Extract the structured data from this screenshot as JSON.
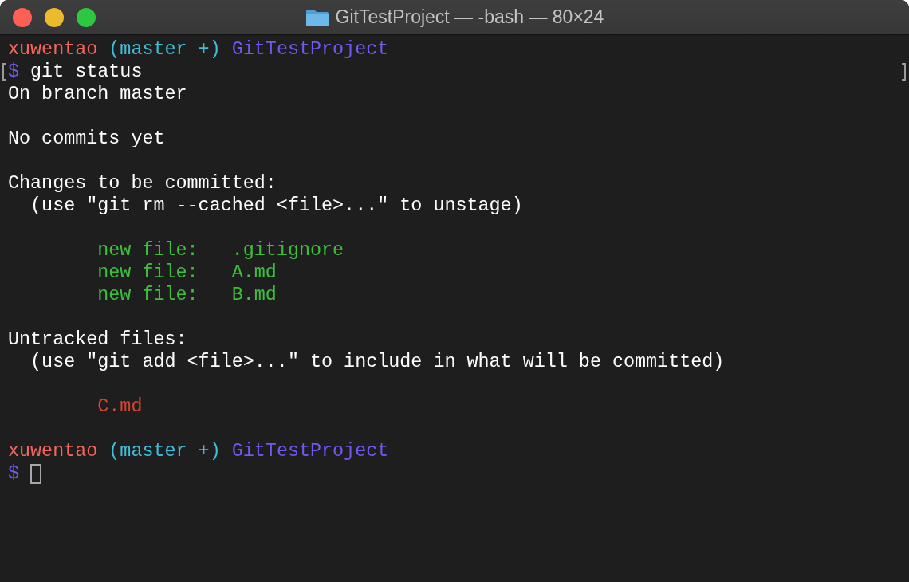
{
  "window": {
    "title": "GitTestProject — -bash — 80×24"
  },
  "blocks": [
    [
      {
        "kind": "prompt",
        "marked": false,
        "cursor": false,
        "segments": [
          {
            "text": "xuwentao",
            "color": "#f2665d"
          },
          {
            "text": "(master +)",
            "color": "#40bfdc"
          },
          {
            "text": "GitTestProject",
            "color": "#7657f0"
          }
        ]
      },
      {
        "kind": "command",
        "marked": true,
        "cursor": false,
        "segments": [
          {
            "text": "$",
            "color": "#7657f0"
          },
          {
            "text": "git status",
            "color": "#ffffff"
          }
        ]
      },
      {
        "kind": "output",
        "marked": false,
        "cursor": false,
        "segments": [
          {
            "text": "On branch master",
            "color": "#ffffff"
          }
        ]
      }
    ],
    [
      {
        "kind": "output",
        "marked": false,
        "cursor": false,
        "segments": [
          {
            "text": "No commits yet",
            "color": "#ffffff"
          }
        ]
      }
    ],
    [
      {
        "kind": "output",
        "marked": false,
        "cursor": false,
        "segments": [
          {
            "text": "Changes to be committed:",
            "color": "#ffffff"
          }
        ]
      },
      {
        "kind": "hint",
        "marked": false,
        "cursor": false,
        "segments": [
          {
            "text": "(use \"git rm --cached <file>...\" to unstage)",
            "color": "#ffffff"
          }
        ]
      }
    ],
    [
      {
        "kind": "entry",
        "marked": false,
        "cursor": false,
        "segments": [
          {
            "text": "new file:   .gitignore",
            "color": "#3cc03c"
          }
        ]
      },
      {
        "kind": "entry",
        "marked": false,
        "cursor": false,
        "segments": [
          {
            "text": "new file:   A.md",
            "color": "#3cc03c"
          }
        ]
      },
      {
        "kind": "entry",
        "marked": false,
        "cursor": false,
        "segments": [
          {
            "text": "new file:   B.md",
            "color": "#3cc03c"
          }
        ]
      }
    ],
    [
      {
        "kind": "output",
        "marked": false,
        "cursor": false,
        "segments": [
          {
            "text": "Untracked files:",
            "color": "#ffffff"
          }
        ]
      },
      {
        "kind": "hint",
        "marked": false,
        "cursor": false,
        "segments": [
          {
            "text": "(use \"git add <file>...\" to include in what will be committed)",
            "color": "#ffffff"
          }
        ]
      }
    ],
    [
      {
        "kind": "entry",
        "marked": false,
        "cursor": false,
        "segments": [
          {
            "text": "C.md",
            "color": "#d8452f"
          }
        ]
      }
    ],
    [
      {
        "kind": "prompt",
        "marked": false,
        "cursor": false,
        "segments": [
          {
            "text": "xuwentao",
            "color": "#f2665d"
          },
          {
            "text": "(master +)",
            "color": "#40bfdc"
          },
          {
            "text": "GitTestProject",
            "color": "#7657f0"
          }
        ]
      },
      {
        "kind": "command",
        "marked": false,
        "cursor": true,
        "segments": [
          {
            "text": "$",
            "color": "#7657f0"
          }
        ]
      }
    ]
  ]
}
